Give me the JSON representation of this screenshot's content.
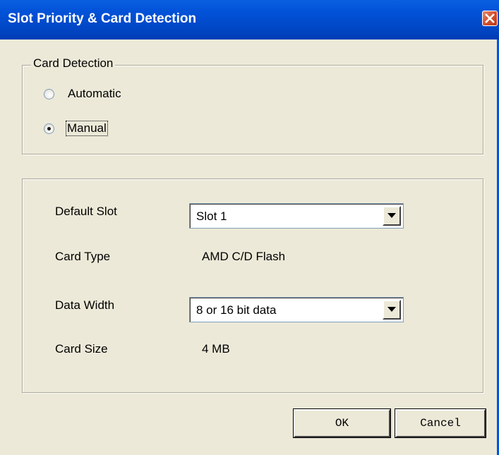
{
  "window": {
    "title": "Slot Priority & Card Detection"
  },
  "card_detection": {
    "legend": "Card Detection",
    "options": [
      {
        "label": "Automatic",
        "checked": false
      },
      {
        "label": "Manual",
        "checked": true
      }
    ]
  },
  "settings": {
    "default_slot": {
      "label": "Default Slot",
      "value": "Slot 1"
    },
    "card_type": {
      "label": "Card Type",
      "value": "AMD C/D Flash"
    },
    "data_width": {
      "label": "Data Width",
      "value": "8 or 16 bit data"
    },
    "card_size": {
      "label": "Card Size",
      "value": "4 MB"
    }
  },
  "buttons": {
    "ok": "OK",
    "cancel": "Cancel"
  },
  "colors": {
    "titlebar": "#0047c6",
    "dialog_bg": "#ece9d8",
    "close_button": "#d4502c"
  }
}
